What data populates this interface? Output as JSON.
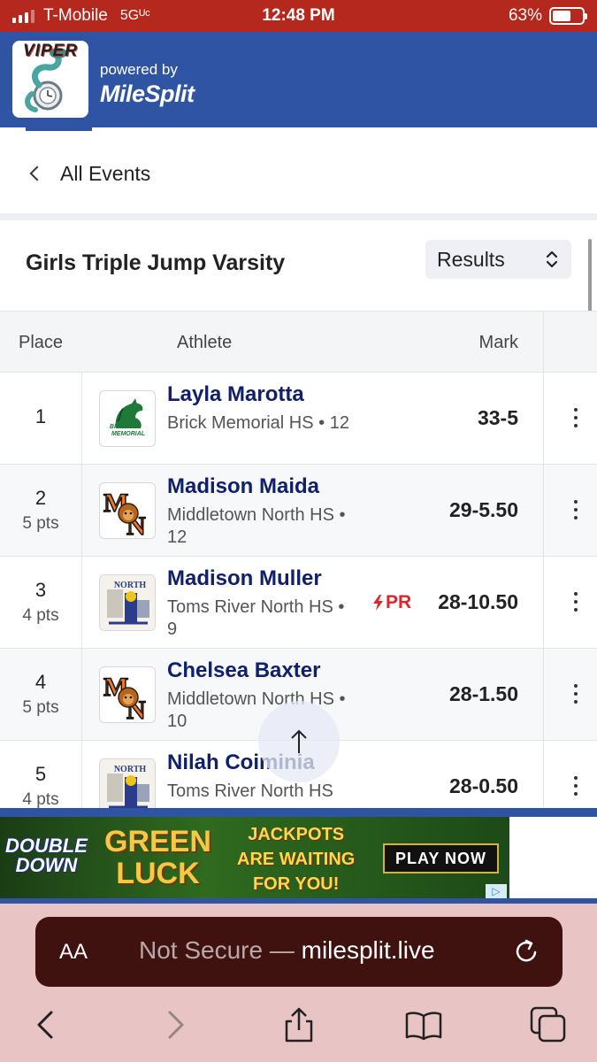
{
  "status_bar": {
    "carrier": "T-Mobile",
    "network": "5Gᵁᶜ",
    "time": "12:48 PM",
    "battery_text": "63%",
    "battery_level": 0.63
  },
  "header": {
    "logo_text": "VIPER",
    "powered_by": "powered by",
    "brand": "MileSplit"
  },
  "nav": {
    "back_label": "All Events"
  },
  "event": {
    "title": "Girls Triple Jump Varsity",
    "view_select": "Results"
  },
  "table": {
    "headers": {
      "place": "Place",
      "athlete": "Athlete",
      "mark": "Mark"
    },
    "rows": [
      {
        "place": "1",
        "points": "",
        "name": "Layla Marotta",
        "team": "Brick Memorial HS • 12",
        "mark": "33-5",
        "pr": "",
        "logo": "brick-memorial"
      },
      {
        "place": "2",
        "points": "5 pts",
        "name": "Madison Maida",
        "team": "Middletown North HS • 12",
        "mark": "29-5.50",
        "pr": "",
        "logo": "middletown-north"
      },
      {
        "place": "3",
        "points": "4 pts",
        "name": "Madison Muller",
        "team": "Toms River North HS • 9",
        "mark": "28-10.50",
        "pr": "PR",
        "logo": "toms-river-north"
      },
      {
        "place": "4",
        "points": "5 pts",
        "name": "Chelsea Baxter",
        "team": "Middletown North HS • 10",
        "mark": "28-1.50",
        "pr": "",
        "logo": "middletown-north"
      },
      {
        "place": "5",
        "points": "4 pts",
        "name": "Nilah Coiminia",
        "team": "Toms River North HS",
        "mark": "28-0.50",
        "pr": "",
        "logo": "toms-river-north"
      }
    ]
  },
  "ad": {
    "brand_line1": "DOUBLE",
    "brand_line2": "DOWN",
    "headline_line1": "GREEN",
    "headline_line2": "LUCK",
    "tag_line1": "JACKPOTS",
    "tag_line2": "ARE WAITING",
    "tag_line3": "FOR YOU!",
    "cta": "PLAY NOW"
  },
  "browser": {
    "text_size_label": "AA",
    "security": "Not Secure — ",
    "host": "milesplit.live"
  },
  "colors": {
    "status_bar": "#b4281d",
    "header": "#2f54a3",
    "athlete_name": "#10206b",
    "pr": "#e0252b",
    "url_bar": "#3f1210",
    "safari_bg": "#e8c4c4"
  }
}
